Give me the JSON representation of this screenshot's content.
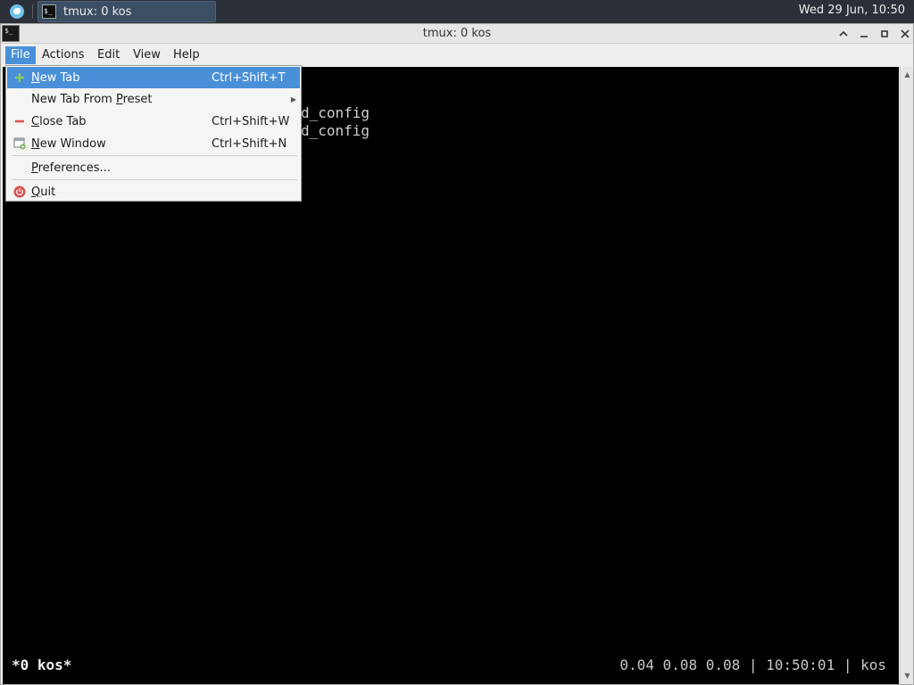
{
  "panel": {
    "task_label": "tmux: 0 kos",
    "clock": "Wed 29 Jun, 10:50"
  },
  "window": {
    "title": "tmux: 0 kos",
    "controls": [
      "chevron-up-icon",
      "minimize-icon",
      "maximize-icon",
      "close-icon"
    ]
  },
  "menubar": {
    "items": [
      "File",
      "Actions",
      "Edit",
      "View",
      "Help"
    ],
    "active": "File"
  },
  "file_menu": {
    "new_tab": {
      "pre": "",
      "mnemonic": "N",
      "post": "ew Tab",
      "shortcut": "Ctrl+Shift+T",
      "icon": "plus-icon"
    },
    "new_tab_from_preset": {
      "pre": "New Tab From ",
      "mnemonic": "P",
      "post": "reset",
      "icon": "submenu-arrow-icon"
    },
    "close_tab": {
      "pre": "",
      "mnemonic": "C",
      "post": "lose Tab",
      "shortcut": "Ctrl+Shift+W",
      "icon": "minus-icon"
    },
    "new_window": {
      "pre": "",
      "mnemonic": "N",
      "post": "ew Window",
      "shortcut": "Ctrl+Shift+N",
      "icon": "new-window-icon"
    },
    "preferences": {
      "pre": "",
      "mnemonic": "P",
      "post": "references...",
      "icon": ""
    },
    "quit": {
      "pre": "",
      "mnemonic": "Q",
      "post": "uit",
      "icon": "power-icon"
    }
  },
  "terminal": {
    "visible_lines": [
      "d_config",
      "d_config"
    ],
    "status_left": "*0 kos*",
    "status_right": "0.04 0.08 0.08 | 10:50:01 | kos"
  },
  "colors": {
    "highlight": "#4a90d9",
    "panel_bg": "#2b3038",
    "terminal_bg": "#000000"
  }
}
